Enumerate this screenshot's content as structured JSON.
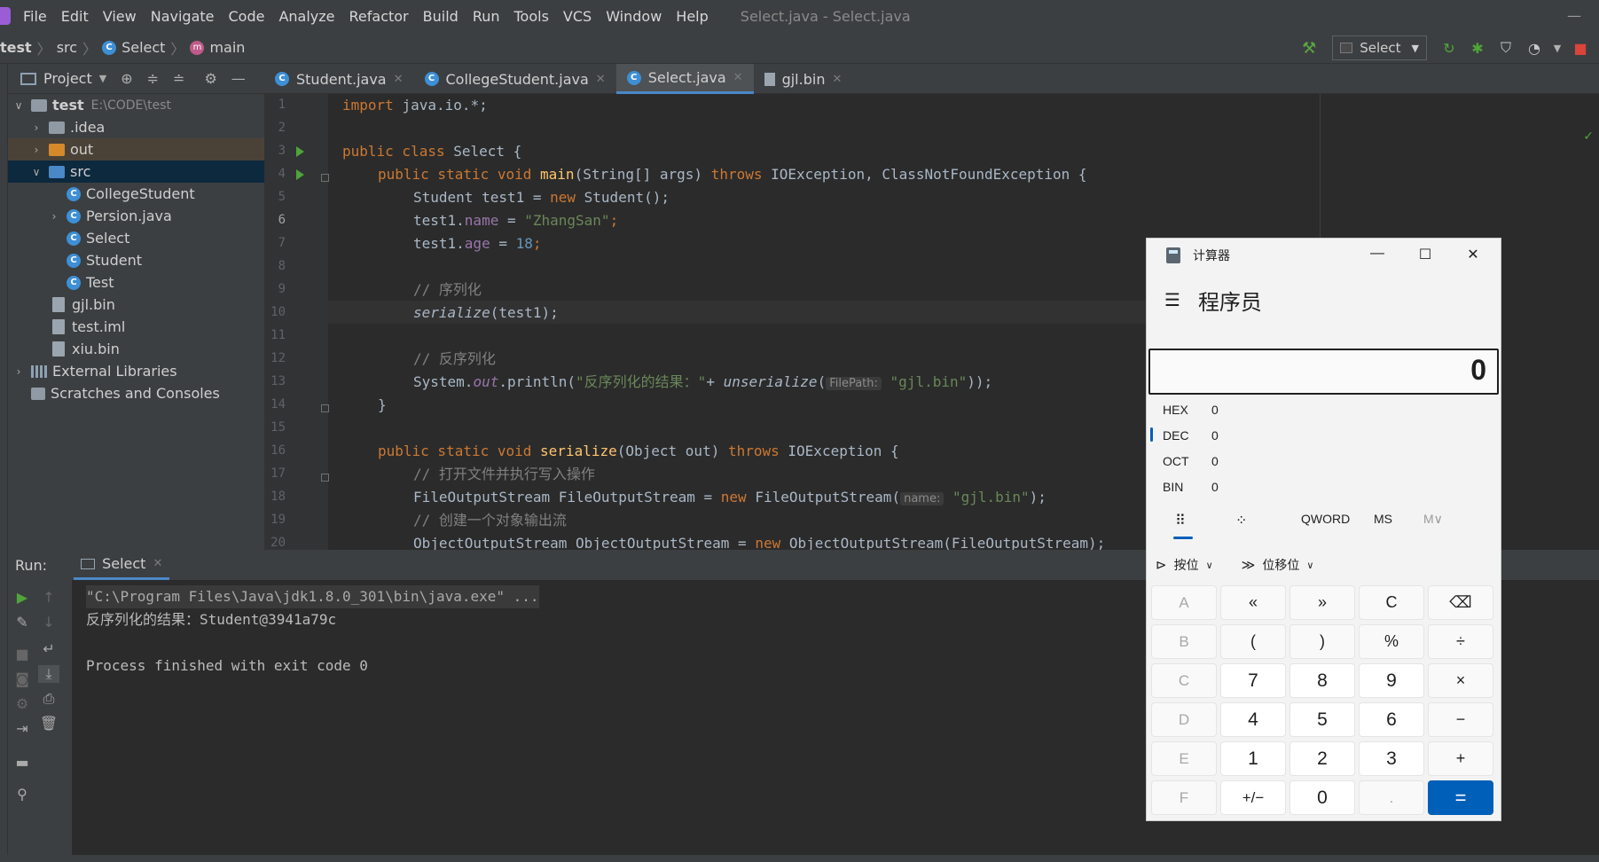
{
  "menu": {
    "items": [
      "File",
      "Edit",
      "View",
      "Navigate",
      "Code",
      "Analyze",
      "Refactor",
      "Build",
      "Run",
      "Tools",
      "VCS",
      "Window",
      "Help"
    ],
    "window_title": "Select.java - Select.java",
    "minimize_glyph": "—"
  },
  "navbar": {
    "breadcrumbs": [
      "test",
      "src",
      "Select",
      "main"
    ],
    "run_config": "Select"
  },
  "project": {
    "title": "Project",
    "root_label": "test",
    "root_path": "E:\\CODE\\test",
    "items": [
      ".idea",
      "out",
      "src",
      "CollegeStudent",
      "Persion.java",
      "Select",
      "Student",
      "Test",
      "gjl.bin",
      "test.iml",
      "xiu.bin",
      "External Libraries",
      "Scratches and Consoles"
    ]
  },
  "editor": {
    "tabs": [
      "Student.java",
      "CollegeStudent.java",
      "Select.java",
      "gjl.bin"
    ],
    "line_numbers": [
      "1",
      "2",
      "3",
      "4",
      "5",
      "6",
      "7",
      "8",
      "9",
      "10",
      "11",
      "12",
      "13",
      "14",
      "15",
      "16",
      "17",
      "18",
      "19",
      "20"
    ],
    "code": {
      "l1_kw": "import ",
      "l1_rest": "java.io.*;",
      "l3_kw": "public class ",
      "l3_rest": "Select {",
      "l4_kw1": "public static void ",
      "l4_fn": "main",
      "l4_mid": "(String[] args) ",
      "l4_kw2": "throws ",
      "l4_rest": "IOException, ClassNotFoundException {",
      "l5_a": "Student test1 = ",
      "l5_kw": "new ",
      "l5_b": "Student();",
      "l6_a": "test1.",
      "l6_fld": "name",
      "l6_b": " = ",
      "l6_str": "\"ZhangSan\"",
      "l6_c": ";",
      "l7_a": "test1.",
      "l7_fld": "age",
      "l7_b": " = ",
      "l7_num": "18",
      "l7_c": ";",
      "l9_cm": "// 序列化",
      "l10_it": "serialize",
      "l10_rest": "(test1);",
      "l12_cm": "// 反序列化",
      "l13_a": "System.",
      "l13_fld": "out",
      "l13_b": ".println(",
      "l13_str1": "\"反序列化的结果：\"",
      "l13_c": "+ ",
      "l13_it": "unserialize",
      "l13_d": "(",
      "l13_hint": "FilePath:",
      "l13_str2": "\"gjl.bin\"",
      "l13_e": "));",
      "l14": "}",
      "l16_kw1": "public static void ",
      "l16_fn": "serialize",
      "l16_mid": "(Object out) ",
      "l16_kw2": "throws ",
      "l16_rest": "IOException {",
      "l17_cm": "// 打开文件并执行写入操作",
      "l18_a": "FileOutputStream FileOutputStream = ",
      "l18_kw": "new ",
      "l18_b": "FileOutputStream(",
      "l18_hint": "name:",
      "l18_str": "\"gjl.bin\"",
      "l18_c": ");",
      "l19_cm": "// 创建一个对象输出流",
      "l20_a": "ObjectOutputStream ObjectOutputStream = ",
      "l20_kw": "new ",
      "l20_b": "ObjectOutputStream(FileOutputStream);"
    }
  },
  "run": {
    "label": "Run:",
    "tab": "Select",
    "console": [
      "\"C:\\Program Files\\Java\\jdk1.8.0_301\\bin\\java.exe\" ...",
      "反序列化的结果：Student@3941a79c",
      "",
      "Process finished with exit code 0"
    ]
  },
  "calculator": {
    "title": "计算器",
    "mode": "程序员",
    "display": "0",
    "radix": [
      {
        "name": "HEX",
        "value": "0"
      },
      {
        "name": "DEC",
        "value": "0"
      },
      {
        "name": "OCT",
        "value": "0"
      },
      {
        "name": "BIN",
        "value": "0"
      }
    ],
    "word_size": "QWORD",
    "memory_store": "MS",
    "memory_list": "M∨",
    "bitwise": "按位",
    "bitshift": "位移位",
    "keys": [
      [
        "A",
        "«",
        "»",
        "C",
        "⌫"
      ],
      [
        "B",
        "(",
        ")",
        "%",
        "÷"
      ],
      [
        "C",
        "7",
        "8",
        "9",
        "×"
      ],
      [
        "D",
        "4",
        "5",
        "6",
        "−"
      ],
      [
        "E",
        "1",
        "2",
        "3",
        "+"
      ],
      [
        "F",
        "+/−",
        "0",
        ".",
        "="
      ]
    ]
  }
}
